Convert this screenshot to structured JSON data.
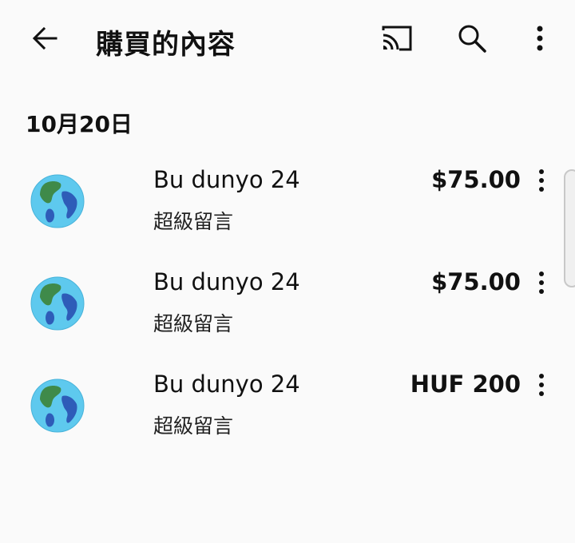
{
  "header": {
    "title": "購買的內容",
    "back_icon": "arrow-back-icon",
    "cast_icon": "cast-icon",
    "search_icon": "search-icon",
    "more_icon": "more-vert-icon"
  },
  "date_group": {
    "label": "10月20日"
  },
  "items": [
    {
      "name": "Bu dunyo 24",
      "type": "超級留言",
      "price": "$75.00",
      "avatar_icon": "globe-icon"
    },
    {
      "name": "Bu dunyo 24",
      "type": "超級留言",
      "price": "$75.00",
      "avatar_icon": "globe-icon"
    },
    {
      "name": "Bu dunyo 24",
      "type": "超級留言",
      "price": "HUF 200",
      "avatar_icon": "globe-icon"
    }
  ],
  "colors": {
    "background": "#fafafa",
    "text": "#111111",
    "globe_ocean": "#5ec9ee",
    "globe_land_green": "#3f8a4a",
    "globe_land_blue": "#2e5cb8"
  }
}
